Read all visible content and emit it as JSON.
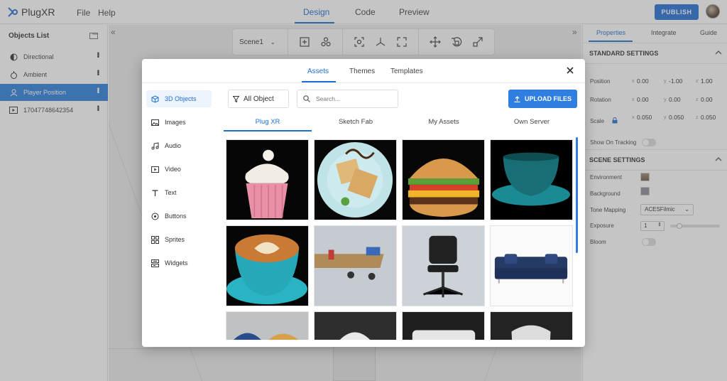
{
  "app": {
    "logo_text": "PlugXR",
    "menu": [
      "File",
      "Help"
    ],
    "modes": [
      "Design",
      "Code",
      "Preview"
    ],
    "publish_label": "PUBLISH"
  },
  "objects_panel": {
    "title": "Objects List",
    "items": [
      {
        "label": "Directional",
        "icon": "directional-light-icon",
        "selected": false
      },
      {
        "label": "Ambient",
        "icon": "ambient-light-icon",
        "selected": false
      },
      {
        "label": "Player Position",
        "icon": "player-position-icon",
        "selected": true
      },
      {
        "label": "17047748642354",
        "icon": "video-icon",
        "selected": false
      }
    ]
  },
  "scene_toolbar": {
    "scene_name": "Scene1",
    "tools": [
      "add-object-icon",
      "group-icon",
      "focus-icon",
      "axis-icon",
      "fullscreen-icon",
      "move-icon",
      "rotate-icon",
      "scale-icon"
    ]
  },
  "properties_panel": {
    "tabs": [
      "Properties",
      "Integrate",
      "Guide"
    ],
    "standard_settings": "STANDARD SETTINGS",
    "position": {
      "label": "Position",
      "x": "0.00",
      "y": "-1.00",
      "z": "1.00"
    },
    "rotation": {
      "label": "Rotation",
      "x": "0.00",
      "y": "0.00",
      "z": "0.00"
    },
    "scale": {
      "label": "Scale",
      "x": "0.050",
      "y": "0.050",
      "z": "0.050"
    },
    "axis_labels": [
      "x",
      "y",
      "z"
    ],
    "show_on_tracking": "Show On Tracking",
    "scene_settings": "SCENE SETTINGS",
    "environment": "Environment",
    "background": "Background",
    "tone_mapping": {
      "label": "Tone Mapping",
      "value": "ACESFilmic"
    },
    "exposure": {
      "label": "Exposure",
      "value": "1",
      "slider_fraction": 0.18
    },
    "bloom": "Bloom"
  },
  "assets_modal": {
    "tabs": [
      "Assets",
      "Themes",
      "Templates"
    ],
    "active_tab": "Assets",
    "categories": [
      {
        "label": "3D Objects",
        "icon": "cube-icon"
      },
      {
        "label": "Images",
        "icon": "image-icon"
      },
      {
        "label": "Audio",
        "icon": "music-note-icon"
      },
      {
        "label": "Video",
        "icon": "play-icon"
      },
      {
        "label": "Text",
        "icon": "text-icon"
      },
      {
        "label": "Buttons",
        "icon": "button-icon"
      },
      {
        "label": "Sprites",
        "icon": "sprites-icon"
      },
      {
        "label": "Widgets",
        "icon": "widgets-icon"
      }
    ],
    "filter_label": "All Object",
    "search_placeholder": "Search...",
    "upload_label": "UPLOAD FILES",
    "source_tabs": [
      "Plug XR",
      "Sketch Fab",
      "My Assets",
      "Own Server"
    ],
    "assets": [
      "cupcake",
      "waffle-plate",
      "burger",
      "teal-cup",
      "coffee-latte",
      "office-desks",
      "office-chair",
      "navy-sofa",
      "chairs-blue",
      "white-chair",
      "white-sofa",
      "armchair"
    ]
  },
  "colors": {
    "accent": "#2571d6",
    "selected_row": "#2d80db"
  }
}
